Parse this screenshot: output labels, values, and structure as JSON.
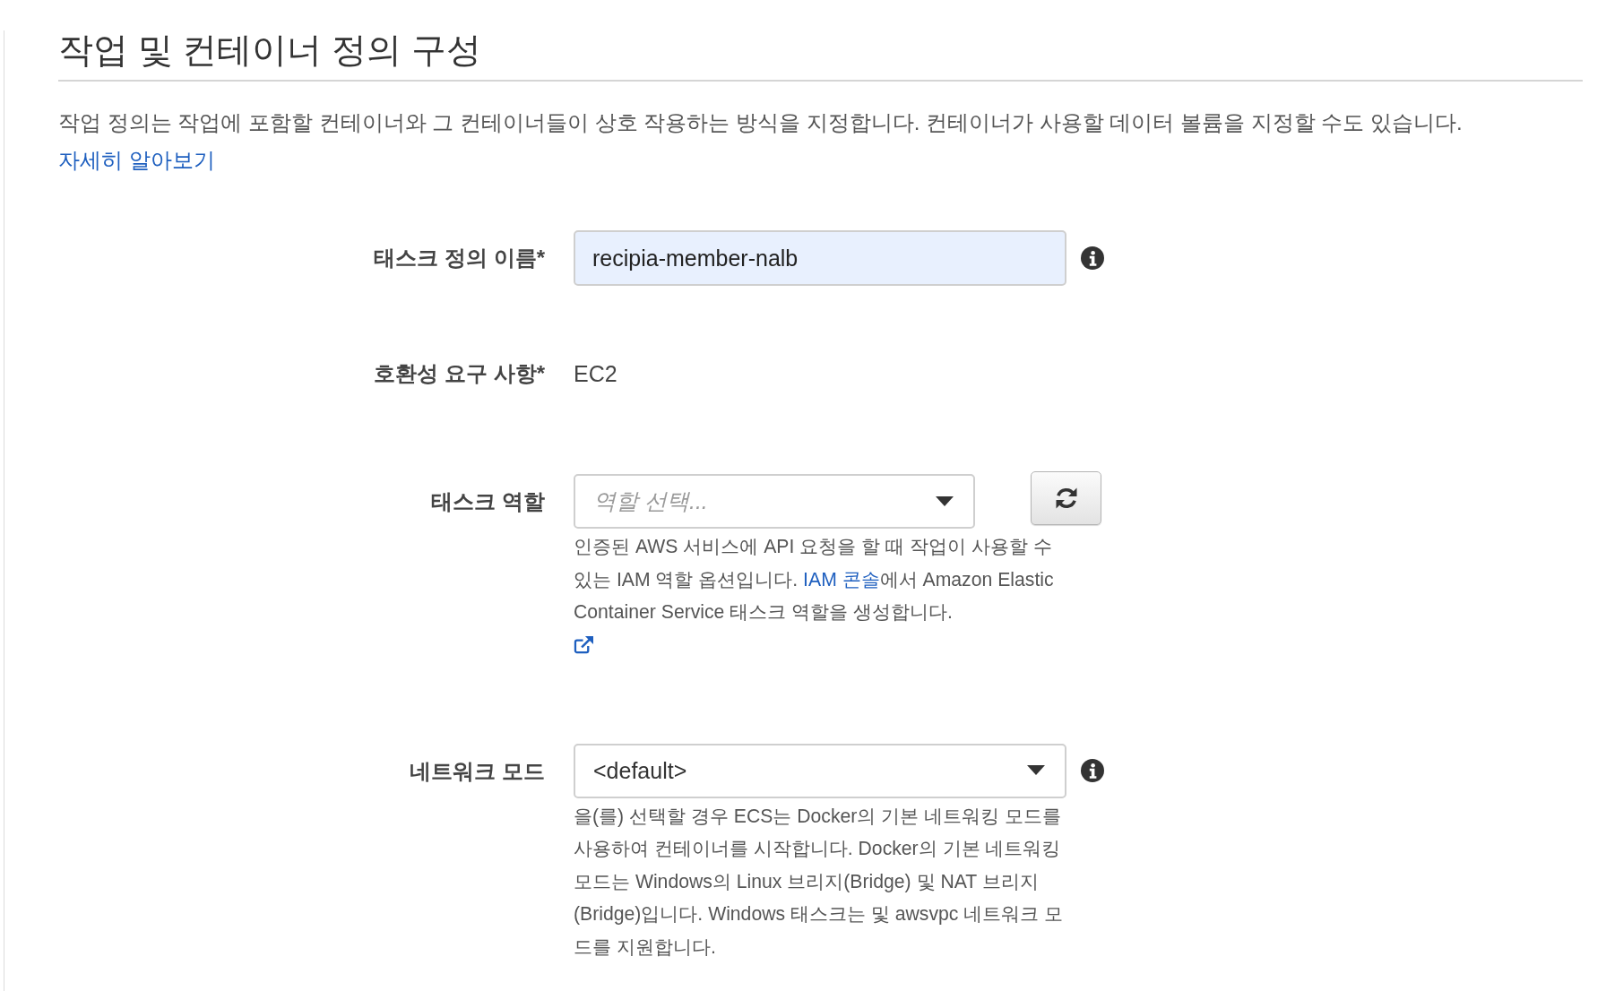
{
  "section": {
    "title": "작업 및 컨테이너 정의 구성",
    "description": [
      {
        "kind": "text",
        "text": "작업 정의는 작업에 포함할 컨테이너와 그 컨테이너들이 상호 작용하는 방식을 지정합니다. 컨테이너가 사용할 데이터 볼륨을 지정할 수도 있습니다. "
      },
      {
        "kind": "link",
        "text": "자세히 알아보기"
      }
    ]
  },
  "fields": [
    {
      "kind": "text_input",
      "label": "태스크 정의 이름*",
      "value": "recipia-member-nalb",
      "info": true
    },
    {
      "kind": "static",
      "label": "호환성 요구 사항*",
      "value": "EC2"
    },
    {
      "kind": "select",
      "label": "태스크 역할",
      "placeholder": "역할 선택...",
      "refresh_button": true,
      "help": [
        {
          "kind": "text",
          "text": "인증된 AWS 서비스에 API 요청을 할 때 작업이 사용할 수 있는 IAM 역할 옵션입니다. "
        },
        {
          "kind": "link",
          "text": "IAM 콘솔"
        },
        {
          "kind": "text",
          "text": "에서 Amazon Elastic Container Service 태스크 역할을 생성합니다."
        }
      ],
      "external_link_icon": true
    },
    {
      "kind": "select",
      "label": "네트워크 모드",
      "value": "<default>",
      "info": true,
      "help": [
        {
          "kind": "text",
          "text": "을(를) 선택할 경우 ECS는 Docker의 기본 네트워킹 모드를 사용하여 컨테이너를 시작합니다. Docker의 기본 네트워킹 모드는 Windows의 Linux 브리지(Bridge) 및 NAT 브리지(Bridge)입니다. Windows 태스크는 및 awsvpc 네트워크 모드를 지원합니다."
        }
      ]
    }
  ]
}
